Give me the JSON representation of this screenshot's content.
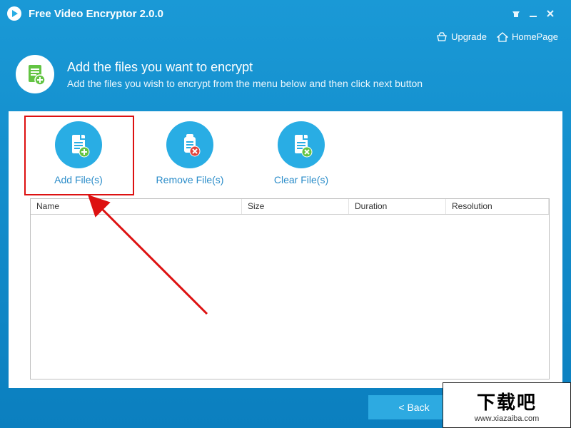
{
  "app": {
    "title": "Free Video Encryptor 2.0.0"
  },
  "links": {
    "upgrade": "Upgrade",
    "homepage": "HomePage"
  },
  "header": {
    "title": "Add the files you want to encrypt",
    "subtitle": "Add the files you wish to encrypt from the menu below and then click next button"
  },
  "actions": {
    "add": "Add File(s)",
    "remove": "Remove File(s)",
    "clear": "Clear File(s)"
  },
  "table": {
    "columns": {
      "name": "Name",
      "size": "Size",
      "duration": "Duration",
      "resolution": "Resolution"
    },
    "rows": []
  },
  "buttons": {
    "back": "<  Back"
  },
  "watermark": {
    "text": "下载吧",
    "url": "www.xiazaiba.com"
  },
  "colors": {
    "accent": "#29ade4",
    "green": "#63c443",
    "red": "#e2443c"
  }
}
